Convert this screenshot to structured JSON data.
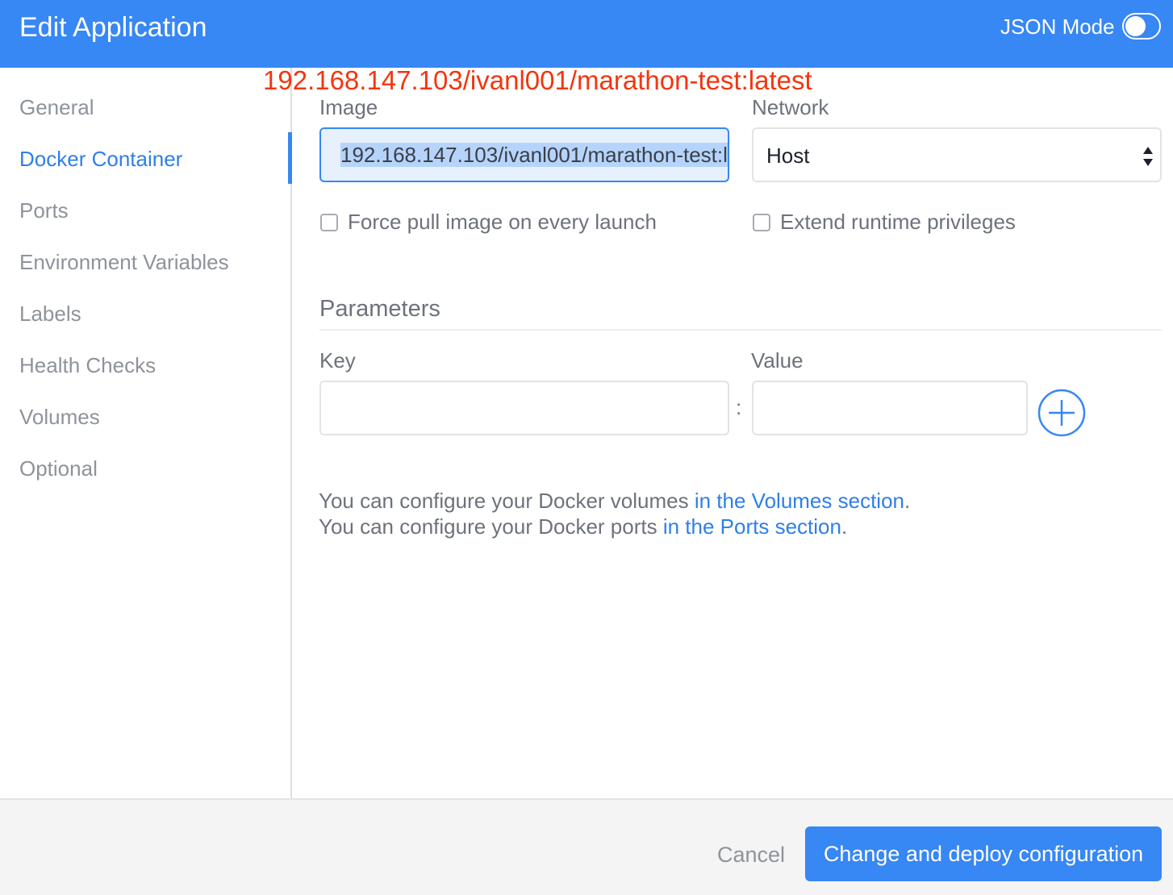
{
  "header": {
    "title": "Edit Application",
    "json_mode_label": "JSON Mode",
    "json_mode_on": false
  },
  "annotation": "192.168.147.103/ivanl001/marathon-test:latest",
  "sidebar": {
    "items": [
      {
        "label": "General",
        "active": false
      },
      {
        "label": "Docker Container",
        "active": true
      },
      {
        "label": "Ports",
        "active": false
      },
      {
        "label": "Environment Variables",
        "active": false
      },
      {
        "label": "Labels",
        "active": false
      },
      {
        "label": "Health Checks",
        "active": false
      },
      {
        "label": "Volumes",
        "active": false
      },
      {
        "label": "Optional",
        "active": false
      }
    ]
  },
  "form": {
    "image_label": "Image",
    "image_value": "192.168.147.103/ivanl001/marathon-test:latest",
    "network_label": "Network",
    "network_value": "Host",
    "force_pull_label": "Force pull image on every launch",
    "force_pull_checked": false,
    "extend_privileges_label": "Extend runtime privileges",
    "extend_privileges_checked": false
  },
  "parameters": {
    "title": "Parameters",
    "key_label": "Key",
    "value_label": "Value",
    "separator": ":",
    "key_value": "",
    "value_value": ""
  },
  "help": {
    "line1_prefix": "You can configure your Docker volumes ",
    "line1_link": "in the Volumes section",
    "line1_suffix": ".",
    "line2_prefix": "You can configure your Docker ports ",
    "line2_link": "in the Ports section",
    "line2_suffix": "."
  },
  "footer": {
    "cancel_label": "Cancel",
    "deploy_label": "Change and deploy configuration"
  },
  "colors": {
    "header_bg": "#3787f4",
    "accent": "#2e7fe8",
    "annotation": "#f2360f"
  }
}
